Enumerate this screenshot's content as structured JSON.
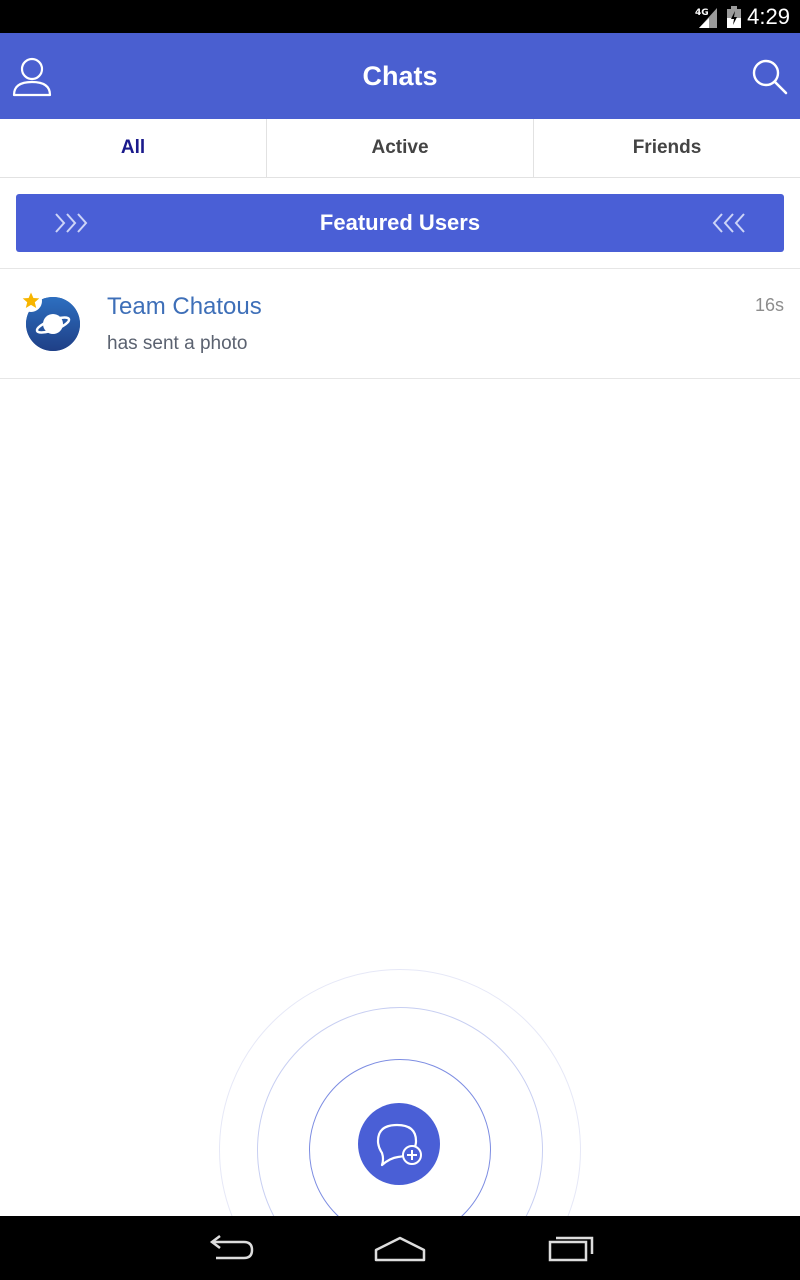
{
  "status_bar": {
    "network": "4G",
    "time": "4:29",
    "icons": [
      "signal-icon",
      "battery-icon"
    ]
  },
  "header": {
    "title": "Chats",
    "left_icon": "profile-icon",
    "right_icon": "search-icon"
  },
  "tabs": [
    {
      "label": "All",
      "active": true
    },
    {
      "label": "Active",
      "active": false
    },
    {
      "label": "Friends",
      "active": false
    }
  ],
  "featured": {
    "label": "Featured Users",
    "left_icon": "chevrons-right-icon",
    "right_icon": "chevrons-left-icon"
  },
  "chats": [
    {
      "name": "Team Chatous",
      "message": "has sent a photo",
      "time": "16s",
      "avatar_icon": "planet-icon",
      "badge_icon": "star-icon"
    }
  ],
  "fab": {
    "icon": "new-chat-icon"
  },
  "nav_bar": {
    "buttons": [
      "back-icon",
      "home-icon",
      "recents-icon"
    ]
  },
  "colors": {
    "primary": "#4a5fd0",
    "tab_active": "#1a1a8c",
    "chat_name": "#3e6fb8",
    "status_bar": "#000000"
  }
}
